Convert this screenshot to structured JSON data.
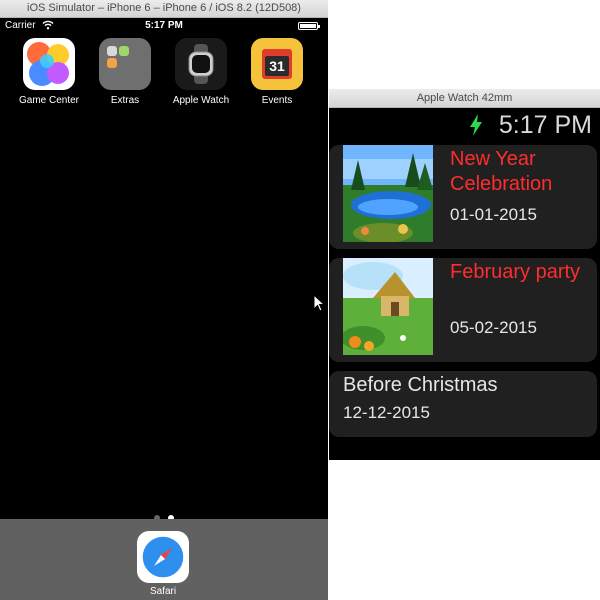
{
  "simulator": {
    "window_title": "iOS Simulator – iPhone 6 – iPhone 6 / iOS 8.2 (12D508)",
    "status_bar": {
      "carrier": "Carrier",
      "time": "5:17 PM"
    },
    "home_apps": [
      {
        "label": "Game Center",
        "icon": "game-center-icon"
      },
      {
        "label": "Extras",
        "icon": "extras-folder-icon"
      },
      {
        "label": "Apple Watch",
        "icon": "apple-watch-icon"
      },
      {
        "label": "Events",
        "icon": "events-calendar-icon",
        "badge_text": "31"
      }
    ],
    "page_dots": {
      "count": 2,
      "active_index": 1
    },
    "dock": {
      "apps": [
        {
          "label": "Safari",
          "icon": "safari-compass-icon"
        }
      ]
    }
  },
  "watch": {
    "window_title": "Apple Watch 42mm",
    "time": "5:17 PM",
    "colors": {
      "event_title": "#ff2d2d",
      "charging_bolt": "#2bd94a",
      "card_bg": "#202020"
    },
    "events": [
      {
        "title": "New Year Celebration",
        "date": "01-01-2015",
        "has_image": true,
        "image": "lake-landscape-image"
      },
      {
        "title": "February party",
        "date": "05-02-2015",
        "has_image": true,
        "image": "cottage-meadow-image"
      },
      {
        "title": "Before Christmas",
        "date": "12-12-2015",
        "has_image": false
      }
    ]
  }
}
